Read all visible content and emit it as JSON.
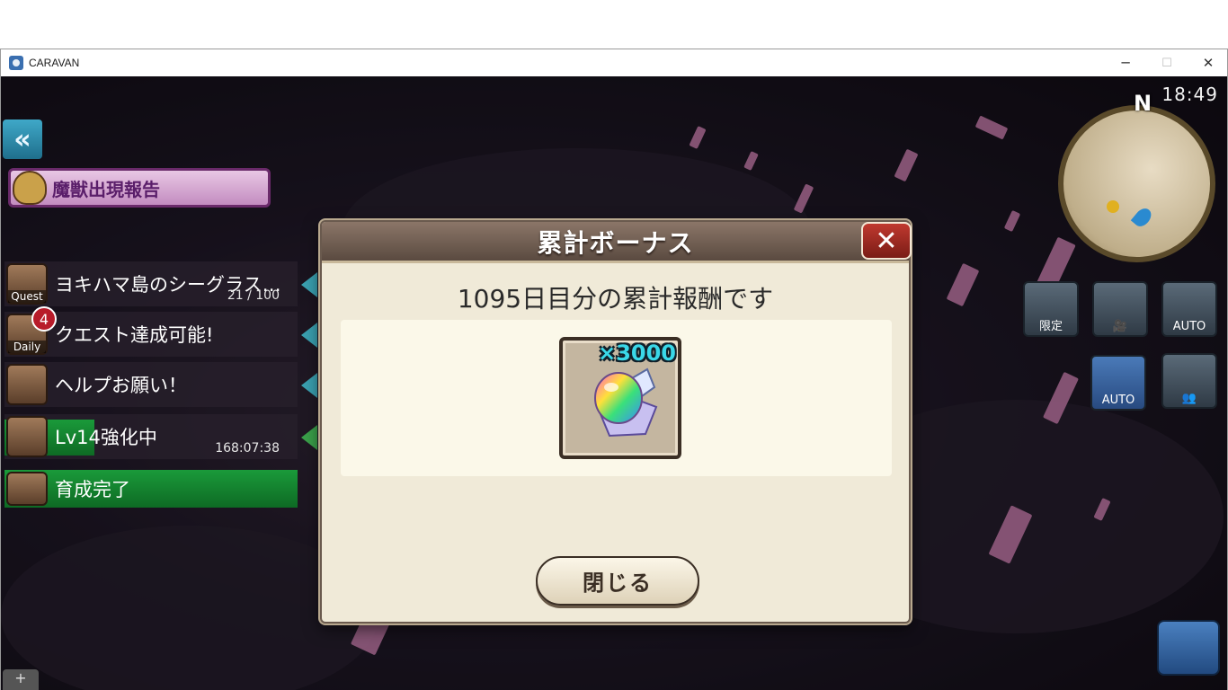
{
  "window": {
    "title": "CARAVAN",
    "minimize": "─",
    "maximize": "☐",
    "close": "✕"
  },
  "hud": {
    "clock": "18:49",
    "compass": "N",
    "report_label": "魔獣出現報告",
    "quests": [
      {
        "icon_caption": "Quest",
        "text": "ヨキハマ島のシーグラス…",
        "sub": "21 / 100"
      },
      {
        "icon_caption": "Daily",
        "badge": "4",
        "text": "クエスト達成可能!"
      },
      {
        "text": "ヘルプお願い！"
      },
      {
        "text": "Lv14強化中",
        "sub": "168:07:38"
      },
      {
        "text": "育成完了"
      }
    ],
    "right_buttons": {
      "limited": "限定",
      "auto": "AUTO",
      "battle_auto": "AUTO"
    }
  },
  "dialog": {
    "title": "累計ボーナス",
    "message": "1095日目分の累計報酬です",
    "reward": {
      "quantity": "×3000",
      "icon": "rainbow-gem-icon"
    },
    "close_button": "閉じる",
    "close_x": "✕"
  }
}
